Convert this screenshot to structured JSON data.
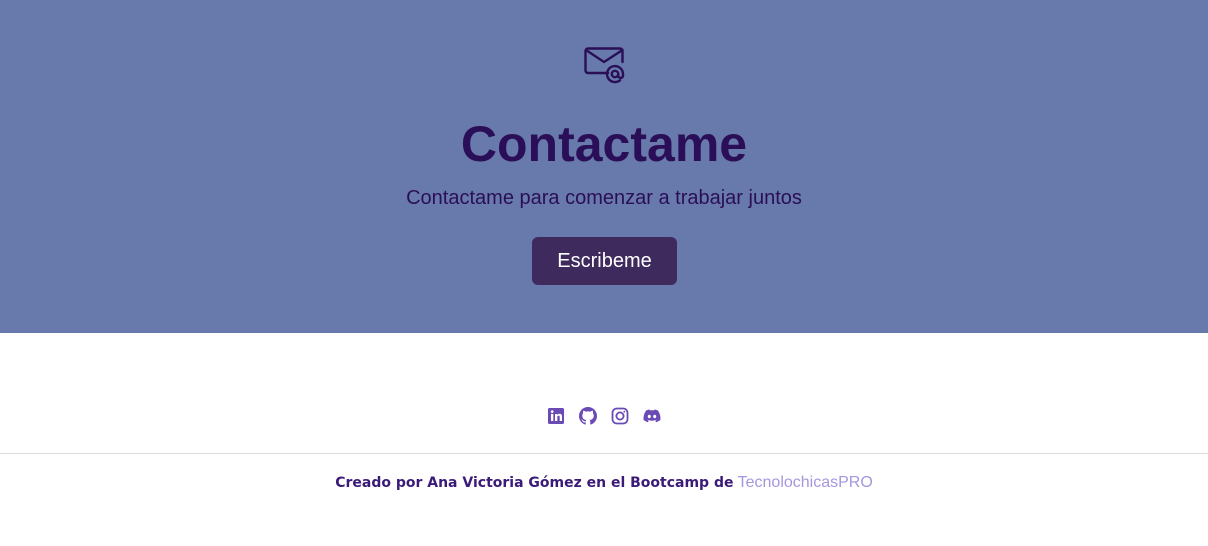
{
  "contact": {
    "icon": "envelope-at-icon",
    "title": "Contactame",
    "subtitle": "Contactame para comenzar a trabajar juntos",
    "button_label": "Escribeme",
    "background_color": "#6879ab",
    "text_color": "#2a0f58",
    "button_color": "#3f2a5e"
  },
  "footer": {
    "social_icons": [
      "linkedin-icon",
      "github-icon",
      "instagram-icon",
      "discord-icon"
    ],
    "credits_text": "Creado por Ana Victoria Gómez en el Bootcamp de",
    "credits_link": "TecnolochicasPRO",
    "icon_color": "#6a4bb6",
    "link_color": "#a596de"
  }
}
